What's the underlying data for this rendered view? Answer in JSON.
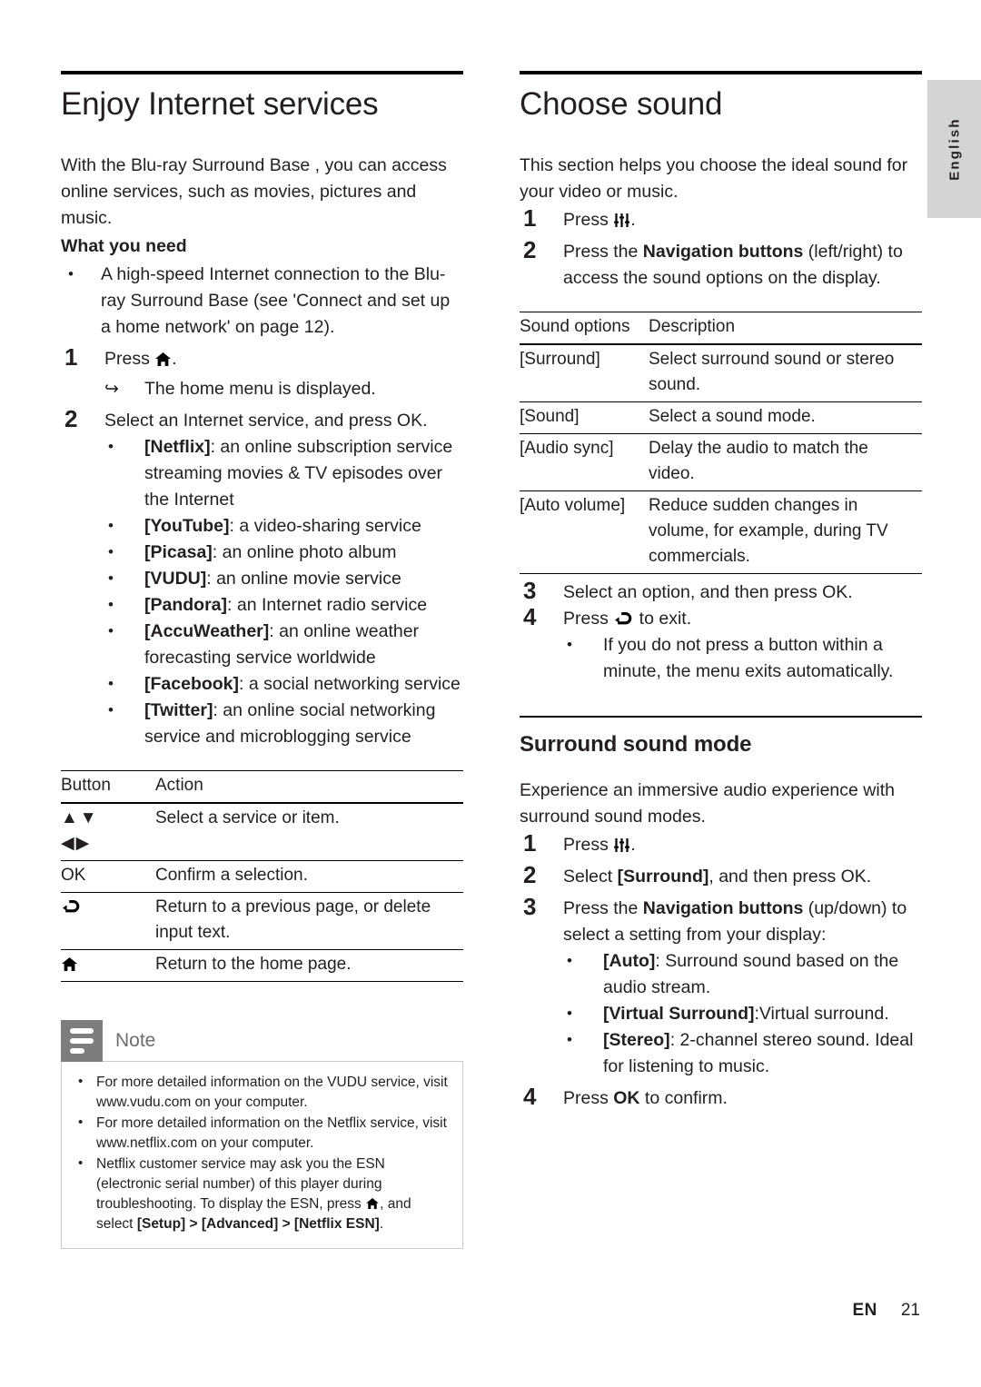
{
  "language_tab": {
    "label": "English"
  },
  "left_column": {
    "title": "Enjoy Internet services",
    "intro": "With the Blu-ray Surround Base , you can access online services, such as movies, pictures and music.",
    "what_you_need_heading": "What you need",
    "requirement_bullet": "A high-speed Internet connection to the Blu-ray Surround Base  (see 'Connect and set up a home network' on page 12).",
    "steps": [
      {
        "num": "1",
        "text_before": "Press ",
        "icon": "home-icon",
        "text_after": "."
      },
      {
        "num": "2",
        "text": "Select an Internet service, and press OK."
      }
    ],
    "step1_result": "The home menu is displayed.",
    "services": [
      {
        "name": "[Netflix]",
        "desc": ": an online subscription service streaming movies & TV episodes over the Internet"
      },
      {
        "name": "[YouTube]",
        "desc": ": a video-sharing service"
      },
      {
        "name": "[Picasa]",
        "desc": ": an online photo album"
      },
      {
        "name": "[VUDU]",
        "desc": ": an online movie service"
      },
      {
        "name": "[Pandora]",
        "desc": ": an Internet radio service"
      },
      {
        "name": "[AccuWeather]",
        "desc": ": an online weather forecasting service worldwide"
      },
      {
        "name": "[Facebook]",
        "desc": ": a social networking service"
      },
      {
        "name": "[Twitter]",
        "desc": ": an online social networking service and microblogging service"
      }
    ],
    "button_table": {
      "headers": [
        "Button",
        "Action"
      ],
      "rows": [
        {
          "button_glyph": "▲▼",
          "button_glyph2": "◀▶",
          "action": "Select a service or item."
        },
        {
          "button": "OK",
          "action": "Confirm a selection."
        },
        {
          "button_icon": "back-icon",
          "action": "Return to a previous page, or delete input text."
        },
        {
          "button_icon2": "home-icon",
          "action": "Return to the home page."
        }
      ]
    },
    "note": {
      "title": "Note",
      "icon": "note-lines-icon",
      "items": [
        {
          "text": "For more detailed information on the VUDU service, visit www.vudu.com on your computer."
        },
        {
          "text": "For more detailed information on the Netflix service, visit www.netflix.com on your computer."
        },
        {
          "text_1": "Netflix customer service may ask you the ESN (electronic serial number) of this player during troubleshooting. To display the ESN, press ",
          "icon": "home-icon",
          "text_2": ", and select ",
          "path": "[Setup] > [Advanced] > [Netflix ESN]",
          "text_3": "."
        }
      ]
    }
  },
  "right_column": {
    "title": "Choose sound",
    "intro": "This section helps you choose the ideal sound for your video or music.",
    "steps": [
      {
        "num": "1",
        "text_before": "Press ",
        "icon": "sliders-icon",
        "text_after": "."
      },
      {
        "num": "2",
        "text_before": "Press the ",
        "bold": "Navigation buttons",
        "text_after": " (left/right) to access the sound options on the display."
      },
      {
        "num": "3",
        "text": "Select an option, and then press OK."
      },
      {
        "num": "4",
        "text_before": "Press ",
        "icon": "back-icon",
        "text_after": " to exit."
      }
    ],
    "step4_bullet": "If you do not press a button within a minute, the menu exits automatically.",
    "sound_table": {
      "headers": [
        "Sound options",
        "Description"
      ],
      "rows": [
        {
          "option": "[Surround]",
          "description": "Select surround sound or stereo sound."
        },
        {
          "option": "[Sound]",
          "description": "Select a sound mode."
        },
        {
          "option": "[Audio sync]",
          "description": "Delay the audio to match the video."
        },
        {
          "option": "[Auto volume]",
          "description": "Reduce sudden changes in volume, for example, during TV commercials."
        }
      ]
    },
    "surround_section": {
      "heading": "Surround sound mode",
      "intro": "Experience an immersive audio experience with surround sound modes.",
      "steps": [
        {
          "num": "1",
          "text_before": "Press ",
          "icon": "sliders-icon",
          "text_after": "."
        },
        {
          "num": "2",
          "text_before": "Select ",
          "bold": "[Surround]",
          "text_after": ", and then press OK."
        },
        {
          "num": "3",
          "text_before": "Press the ",
          "bold": "Navigation buttons",
          "text_after": " (up/down) to select a setting from your display:"
        },
        {
          "num": "4",
          "text_before": "Press ",
          "bold": "OK",
          "text_after": " to confirm."
        }
      ],
      "settings": [
        {
          "name": "[Auto]",
          "desc": ": Surround sound based on the audio stream."
        },
        {
          "name": "[Virtual Surround]",
          "desc": ":Virtual surround."
        },
        {
          "name": "[Stereo]",
          "desc": ": 2-channel stereo sound. Ideal for listening to music."
        }
      ]
    }
  },
  "footer": {
    "en": "EN",
    "page": "21"
  },
  "colors": {
    "tab_grey": "#d3d5d5",
    "note_icon_grey": "#7d7d7d",
    "note_title_grey": "#6d6e70",
    "text": "#231f20"
  }
}
